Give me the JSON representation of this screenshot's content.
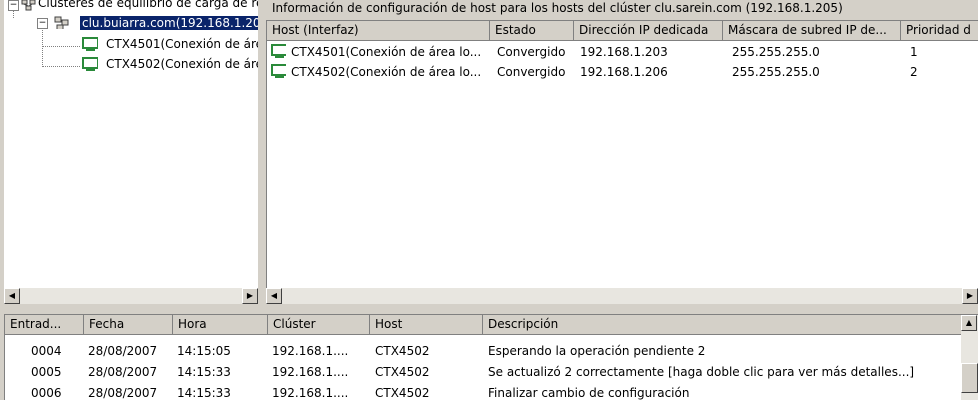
{
  "tree": {
    "root_label": "Clústeres de equilibrio de carga de red",
    "cluster_label": "clu.buiarra.com(192.168.1.20",
    "hosts": [
      "CTX4501(Conexión de áre",
      "CTX4502(Conexión de áre"
    ]
  },
  "right_pane": {
    "title": "Información de configuración de host para los hosts del clúster clu.sarein.com (192.168.1.205)",
    "columns": [
      "Host (Interfaz)",
      "Estado",
      "Dirección IP dedicada",
      "Máscara de subred IP de...",
      "Prioridad d"
    ],
    "rows": [
      [
        "CTX4501(Conexión de área lo...",
        "Convergido",
        "192.168.1.203",
        "255.255.255.0",
        "1"
      ],
      [
        "CTX4502(Conexión de área lo...",
        "Convergido",
        "192.168.1.206",
        "255.255.255.0",
        "2"
      ]
    ]
  },
  "log": {
    "columns": [
      "Entrad...",
      "Fecha",
      "Hora",
      "Clúster",
      "Host",
      "Descripción"
    ],
    "rows": [
      [
        "0004",
        "28/08/2007",
        "14:15:05",
        "192.168.1....",
        "CTX4502",
        "Esperando la operación pendiente 2"
      ],
      [
        "0005",
        "28/08/2007",
        "14:15:33",
        "192.168.1....",
        "CTX4502",
        "Se actualizó 2 correctamente [haga doble clic para ver más detalles...]"
      ],
      [
        "0006",
        "28/08/2007",
        "14:15:33",
        "192.168.1....",
        "CTX4502",
        "Finalizar cambio de configuración"
      ]
    ]
  },
  "icons": {
    "collapse": "minus-box-icon",
    "cluster_root": "clusters-icon",
    "cluster": "cluster-icon",
    "host": "host-computer-icon",
    "scroll_left": "arrow-left-icon",
    "scroll_right": "arrow-right-icon",
    "scroll_up": "arrow-up-icon"
  },
  "colors": {
    "selection": "#0a246a",
    "host_icon": "#2a8a3a"
  }
}
